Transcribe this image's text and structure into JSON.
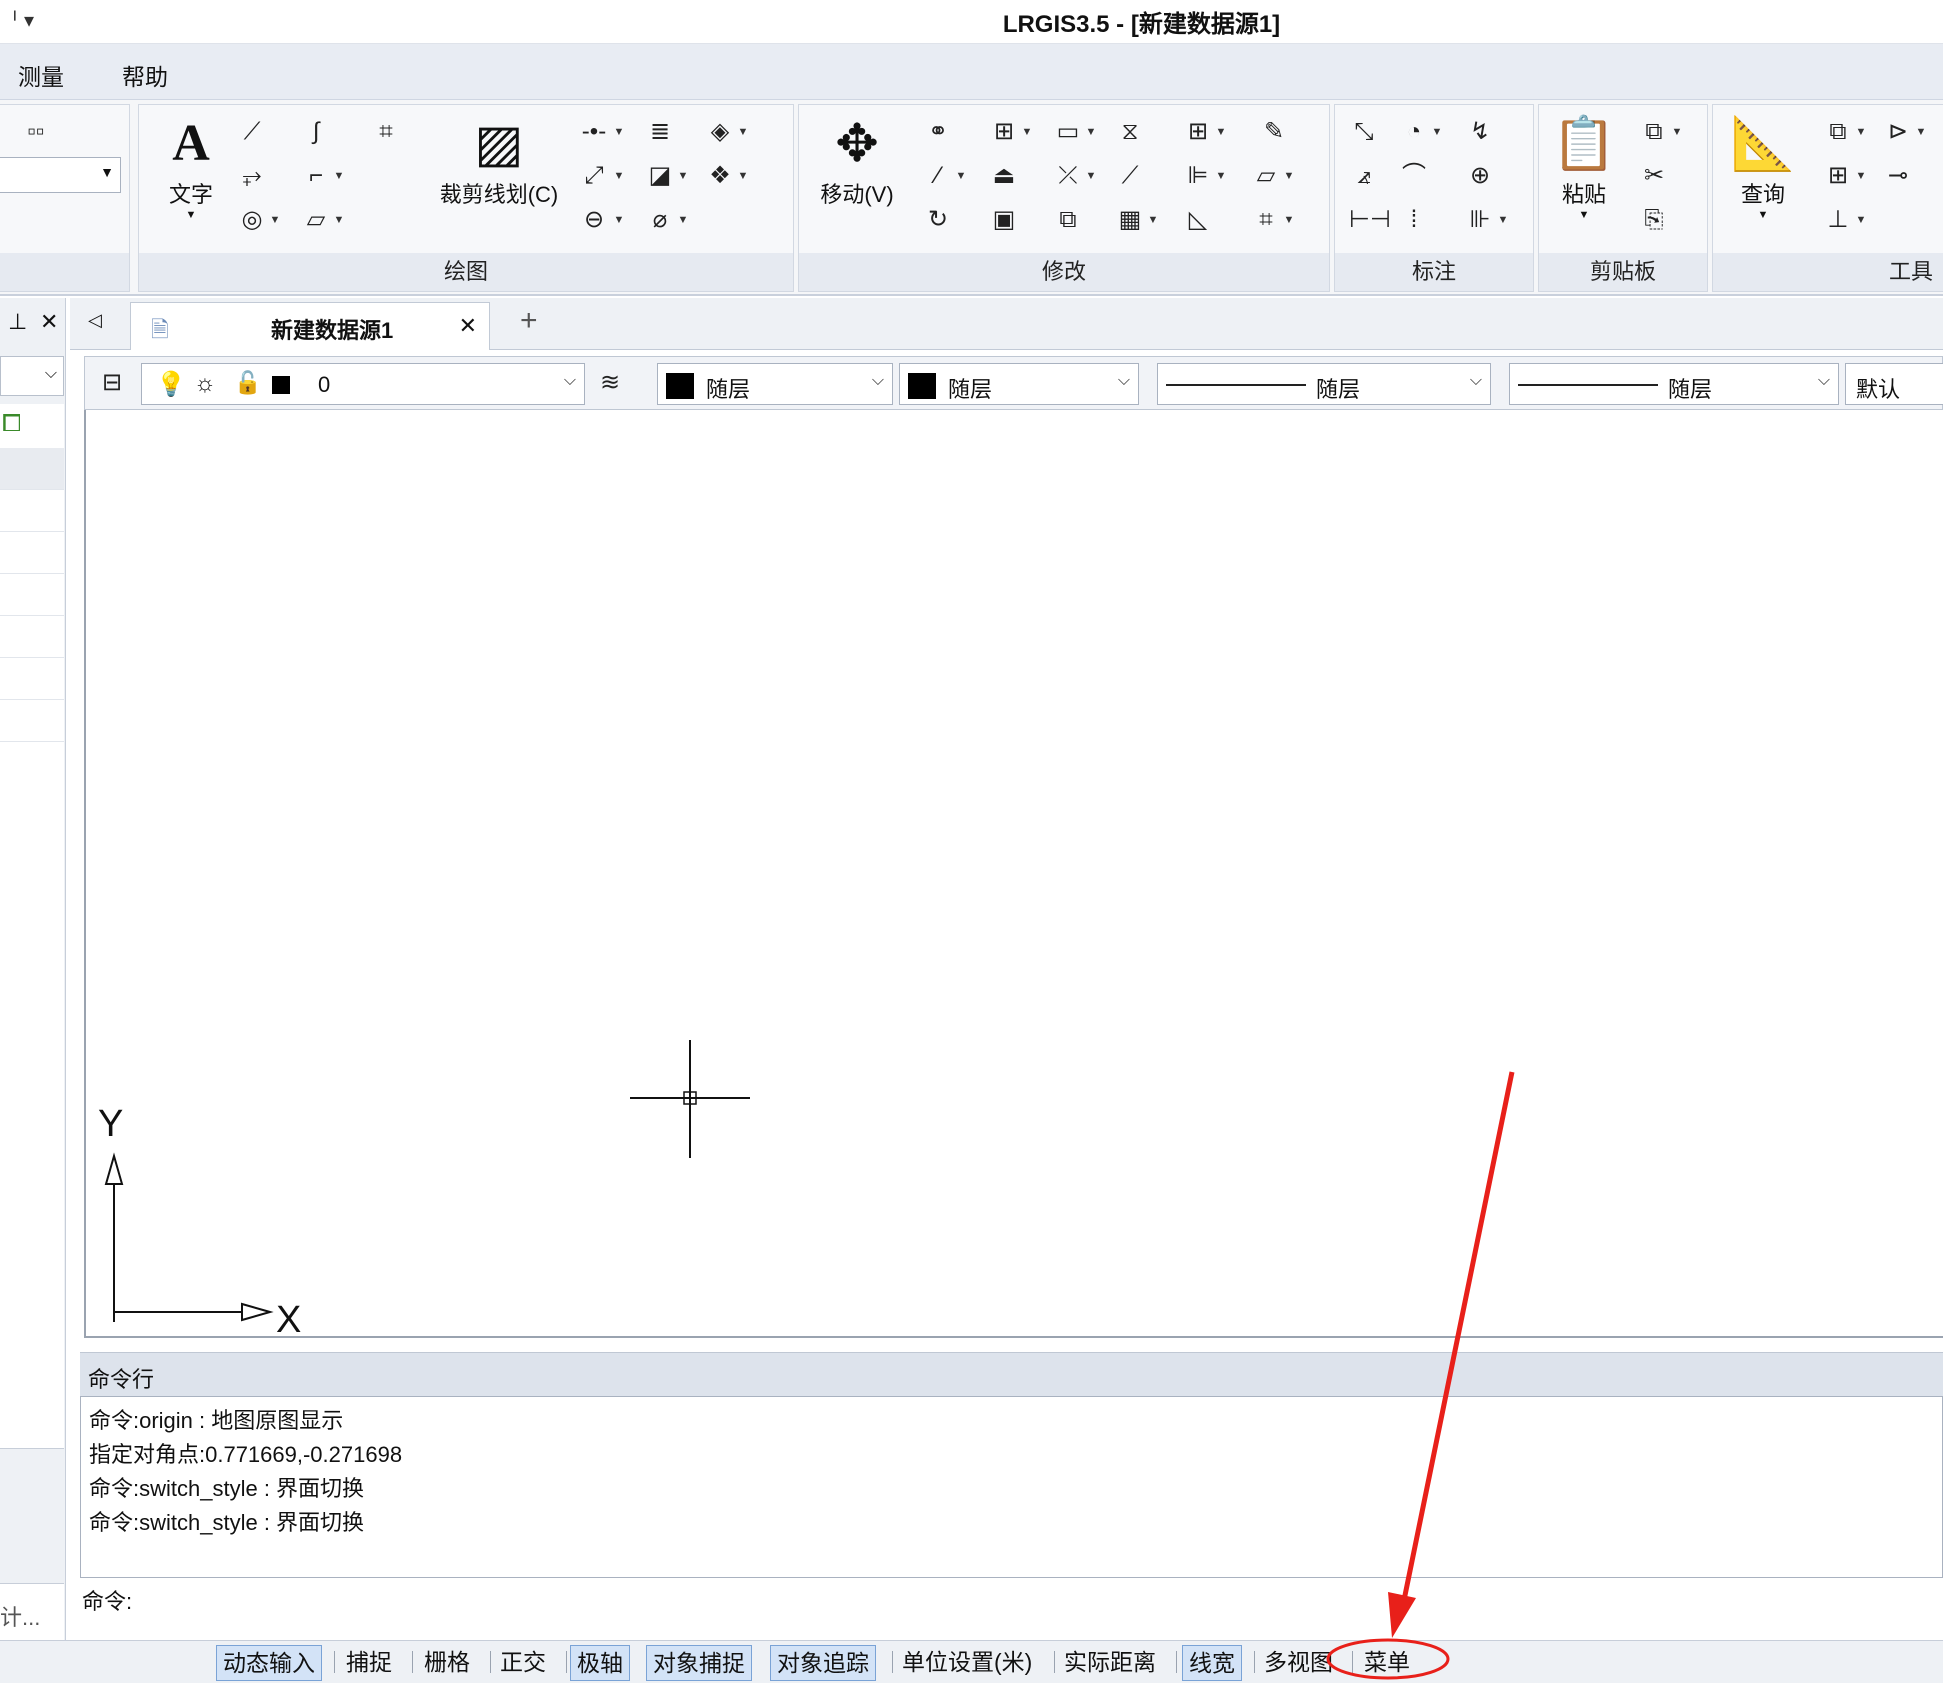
{
  "window": {
    "title": "LRGIS3.5 - [新建数据源1]",
    "quick_access": "ᅵ ▾"
  },
  "menu": {
    "items": [
      "测量",
      "帮助"
    ]
  },
  "ribbon": {
    "panels": {
      "draw": {
        "label": "绘图",
        "text_btn": "文字",
        "clip_btn": "裁剪线划(C)"
      },
      "modify": {
        "label": "修改",
        "move_btn": "移动(V)"
      },
      "annotate": {
        "label": "标注"
      },
      "clipboard": {
        "label": "剪贴板",
        "paste_btn": "粘贴"
      },
      "tools": {
        "label": "工具",
        "query_btn": "查询"
      }
    }
  },
  "tabs": [
    {
      "label": "新建数据源1"
    }
  ],
  "propbar": {
    "layer_value": "0",
    "color_value": "随层",
    "color2_value": "随层",
    "linetype_value": "随层",
    "lineweight_value": "随层",
    "style_value": "默认"
  },
  "canvas": {
    "axis_y": "Y",
    "axis_x": "X"
  },
  "command": {
    "header": "命令行",
    "log": [
      "命令:origin : 地图原图显示",
      "指定对角点:0.771669,-0.271698",
      "命令:switch_style : 界面切换",
      "命令:switch_style : 界面切换"
    ],
    "prompt": "命令:"
  },
  "left": {
    "bottom_text": "计..."
  },
  "statusbar": {
    "items": [
      {
        "label": "动态输入",
        "on": true
      },
      {
        "label": "捕捉",
        "on": false
      },
      {
        "label": "栅格",
        "on": false
      },
      {
        "label": "正交",
        "on": false
      },
      {
        "label": "极轴",
        "on": true
      },
      {
        "label": "对象捕捉",
        "on": true
      },
      {
        "label": "对象追踪",
        "on": true
      },
      {
        "label": "单位设置(米)",
        "on": false
      },
      {
        "label": "实际距离",
        "on": false
      },
      {
        "label": "线宽",
        "on": true
      },
      {
        "label": "多视图",
        "on": false
      },
      {
        "label": "菜单",
        "on": false
      }
    ]
  },
  "colors": {
    "annotation_red": "#e8201a",
    "accent_blue": "#7aa3d6"
  }
}
